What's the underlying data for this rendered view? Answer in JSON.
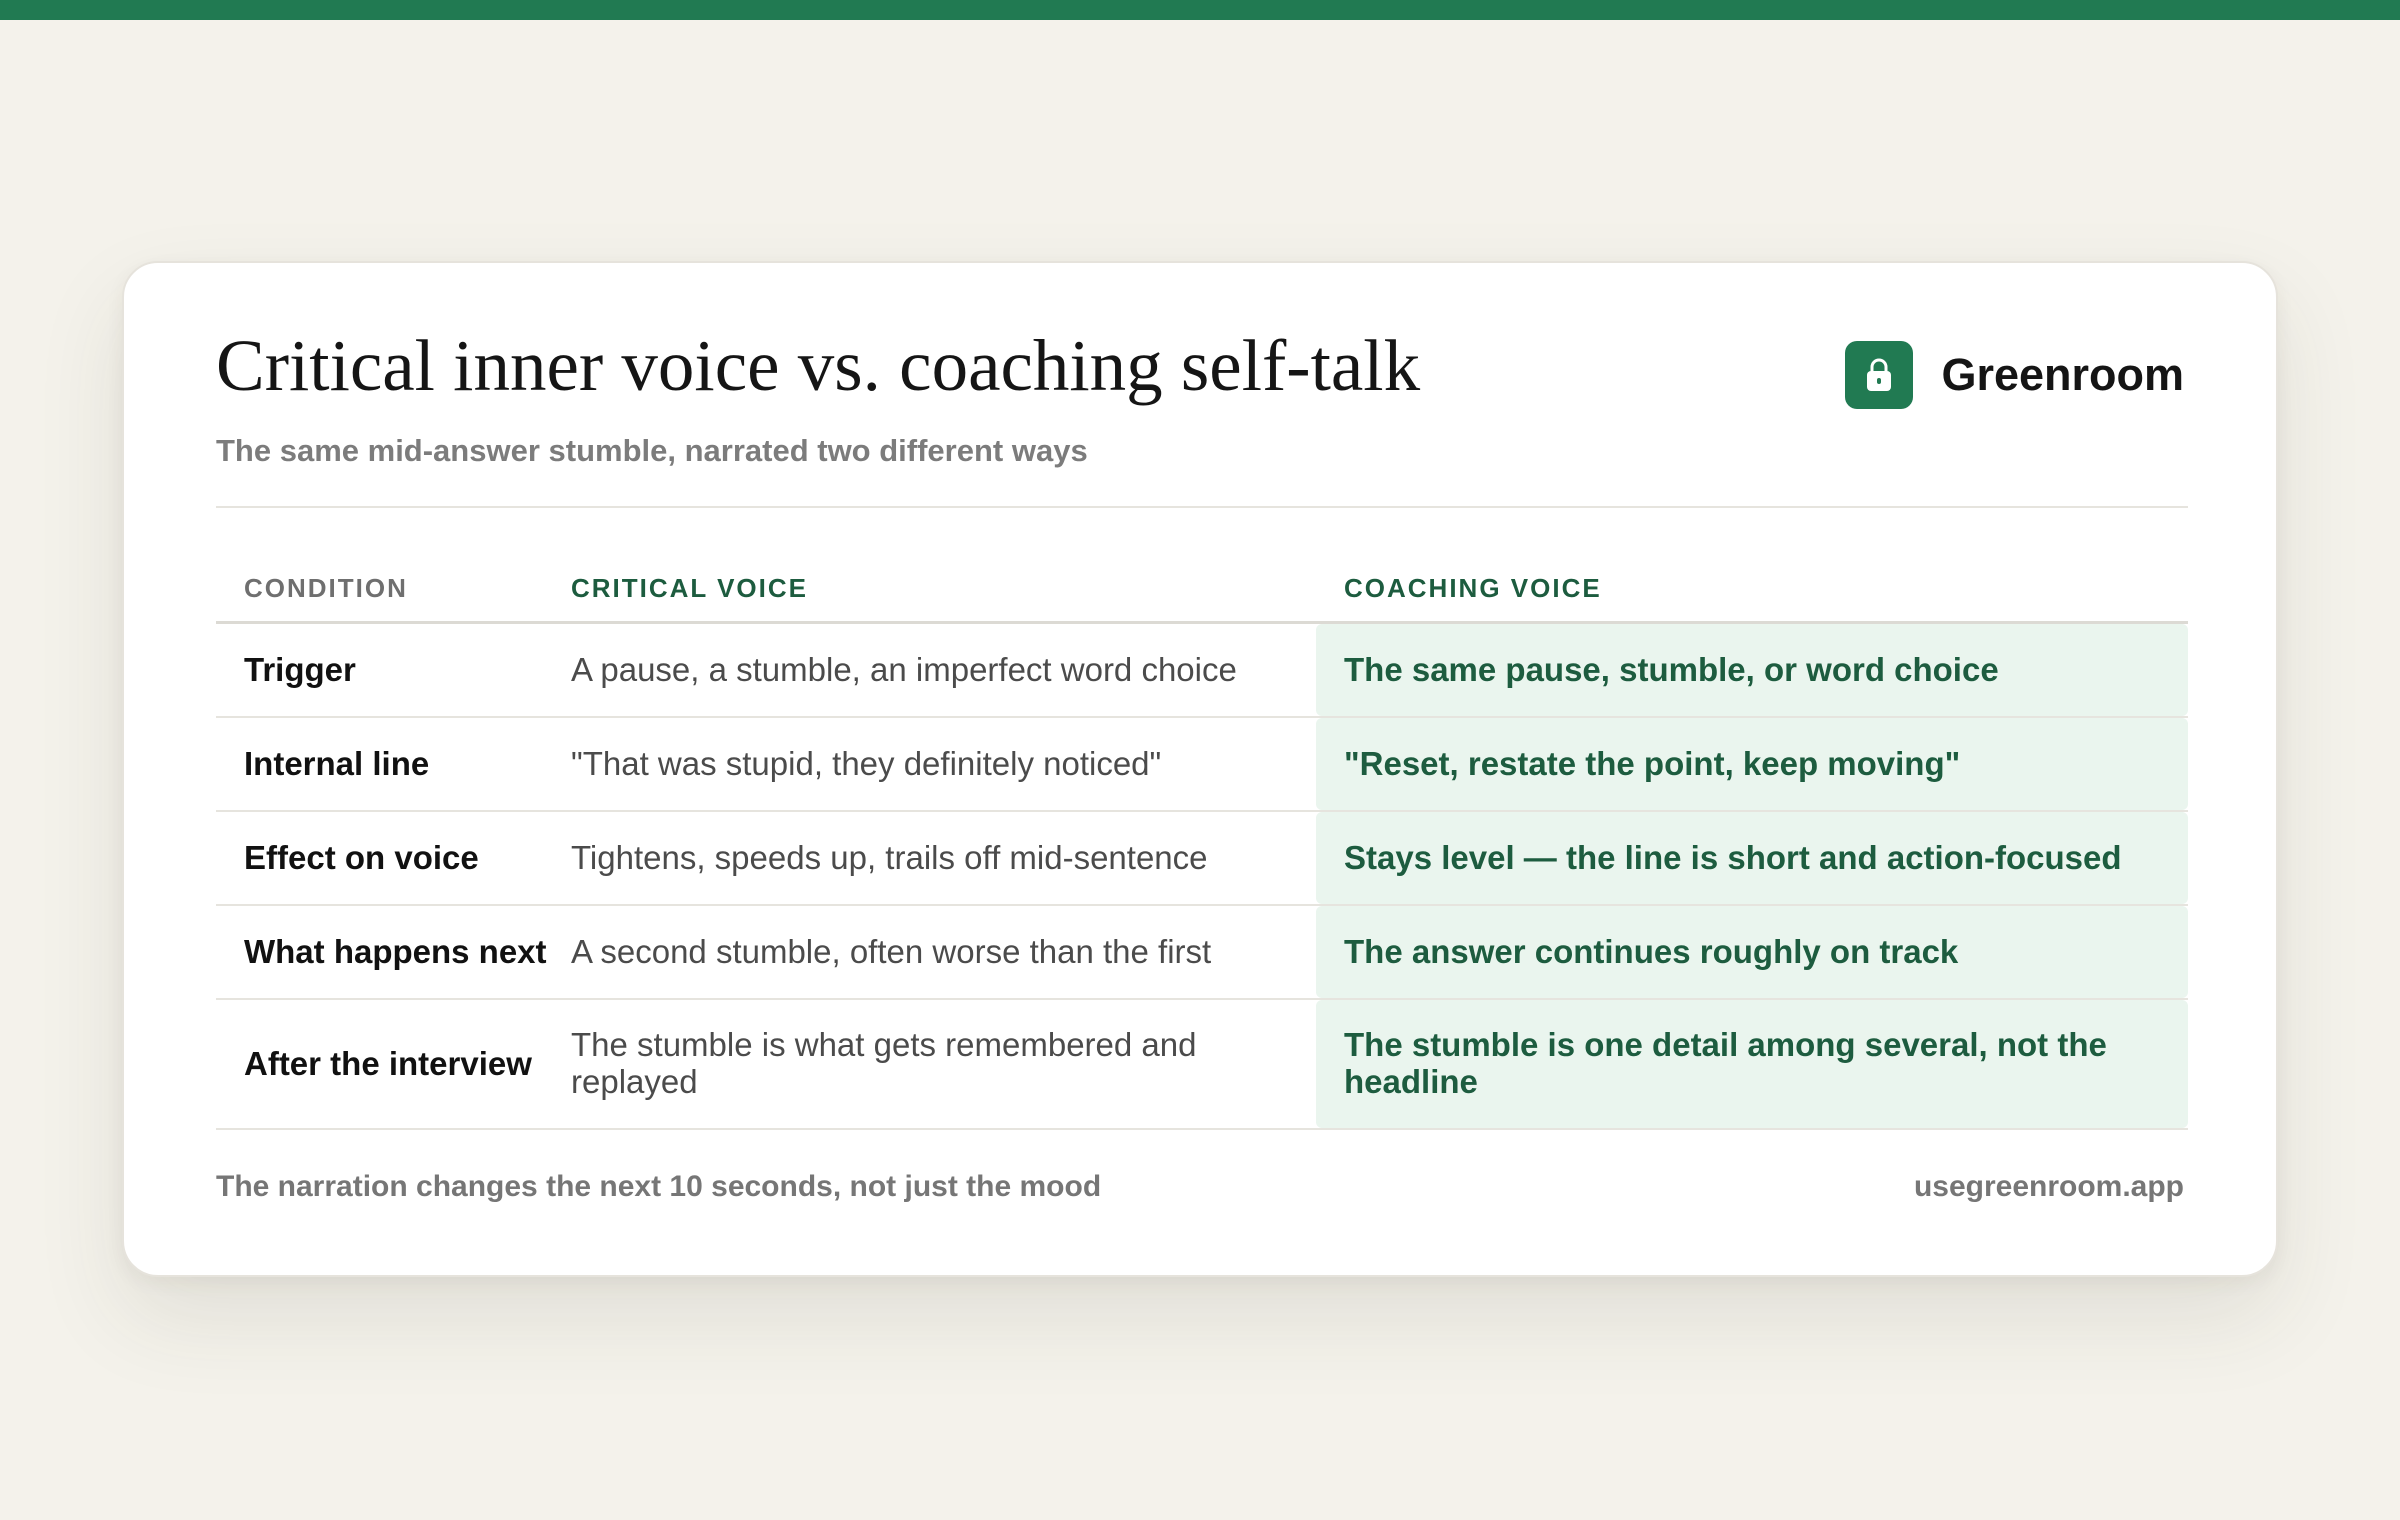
{
  "header": {
    "title": "Critical inner voice vs. coaching self-talk",
    "subtitle": "The same mid-answer stumble, narrated two different ways"
  },
  "brand": {
    "name": "Greenroom",
    "icon": "lock-icon",
    "color": "#217a52"
  },
  "table": {
    "columns": [
      "CONDITION",
      "CRITICAL VOICE",
      "COACHING VOICE"
    ],
    "rows": [
      {
        "condition": "Trigger",
        "critical": "A pause, a stumble, an imperfect word choice",
        "coaching": "The same pause, stumble, or word choice"
      },
      {
        "condition": "Internal line",
        "critical": "\"That was stupid, they definitely noticed\"",
        "coaching": "\"Reset, restate the point, keep moving\""
      },
      {
        "condition": "Effect on voice",
        "critical": "Tightens, speeds up, trails off mid-sentence",
        "coaching": "Stays level — the line is short and action-focused"
      },
      {
        "condition": "What happens next",
        "critical": "A second stumble, often worse than the first",
        "coaching": "The answer continues roughly on track"
      },
      {
        "condition": "After the interview",
        "critical": "The stumble is what gets remembered and replayed",
        "coaching": "The stumble is one detail among several, not the headline"
      }
    ]
  },
  "footer": {
    "note": "The narration changes the next 10 seconds, not just the mood",
    "url": "usegreenroom.app"
  },
  "colors": {
    "accent": "#217a52",
    "coaching_text": "#1d5c3f",
    "coaching_bg": "#eaf5ee",
    "page_bg": "#f4f2eb"
  }
}
